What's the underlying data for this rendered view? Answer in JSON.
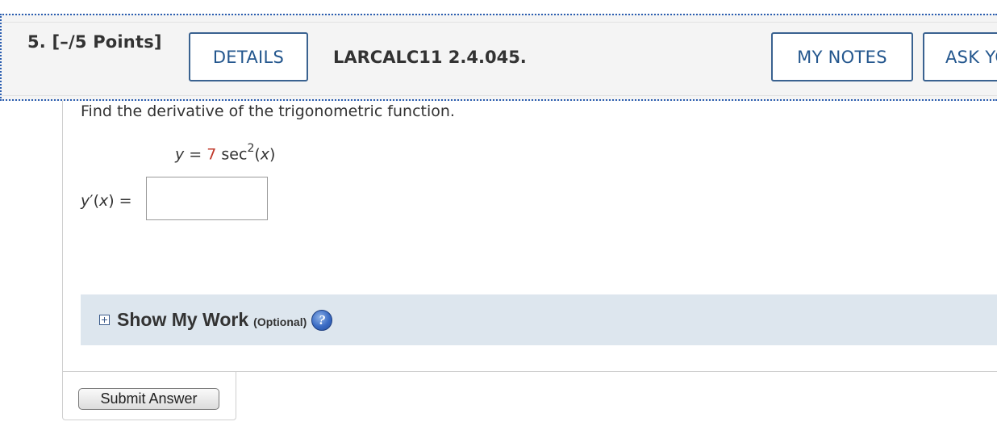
{
  "question": {
    "number_points": "5. [–/5 Points]",
    "details_label": "DETAILS",
    "problem_code": "LARCALC11 2.4.045.",
    "my_notes_label": "MY NOTES",
    "ask_label": "ASK YOUR TEACHER"
  },
  "problem": {
    "prompt": "Find the derivative of the trigonometric function.",
    "equation_lhs": "y",
    "equation_eq": "=",
    "equation_coef": "7",
    "equation_func": "sec",
    "equation_exp": "2",
    "equation_arg_open": "(",
    "equation_arg_var": "x",
    "equation_arg_close": ")",
    "answer_label_var": "y",
    "answer_label_rest": "′(",
    "answer_label_x": "x",
    "answer_label_close": ") =",
    "answer_value": ""
  },
  "show_work": {
    "label": "Show My Work",
    "optional": "(Optional)",
    "help_glyph": "?"
  },
  "submit": {
    "label": "Submit Answer"
  },
  "colors": {
    "accent": "#24578e",
    "coefficient": "#c0392b",
    "show_work_bg": "#dde6ee"
  }
}
